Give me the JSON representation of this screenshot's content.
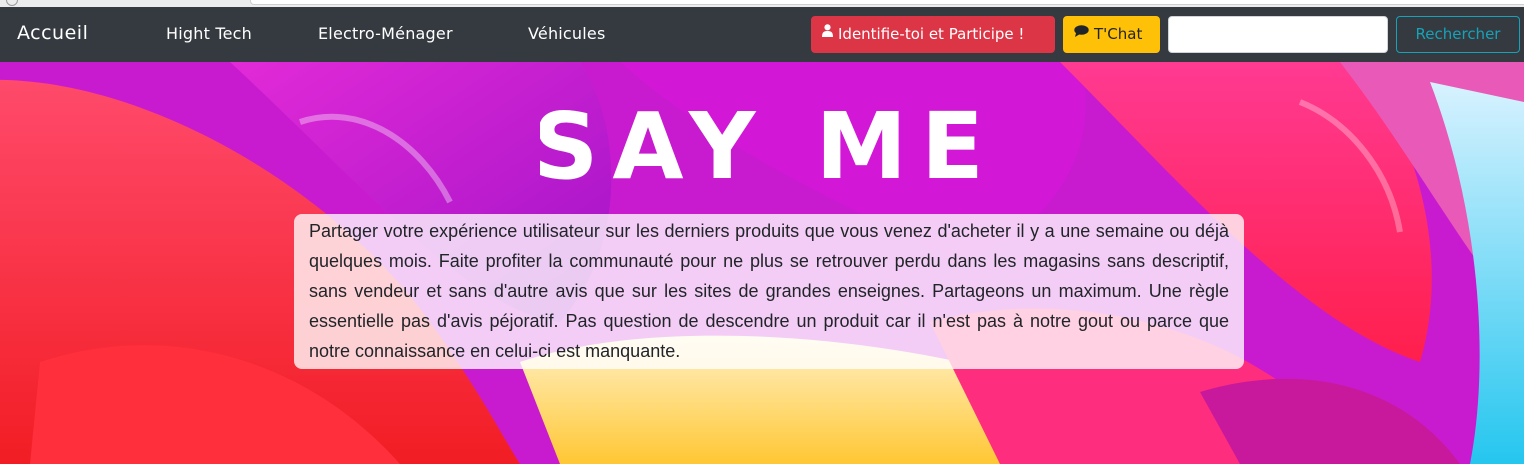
{
  "navbar": {
    "brand": "Accueil",
    "links": [
      {
        "label": "Hight Tech"
      },
      {
        "label": "Electro-Ménager"
      },
      {
        "label": "Véhicules"
      }
    ],
    "login_button": {
      "label": "Identifie-toi et Participe !",
      "icon": "user-icon"
    },
    "chat_button": {
      "label": "T'Chat",
      "icon": "comment-icon"
    },
    "search": {
      "value": "",
      "placeholder": ""
    },
    "search_button": {
      "label": "Rechercher"
    }
  },
  "hero": {
    "logo_text": "SAY ME",
    "description": "Partager votre expérience utilisateur sur les derniers produits que vous venez d'acheter il y a une semaine ou déjà quelques mois. Faite profiter la communauté pour ne plus se retrouver perdu dans les magasins sans descriptif, sans vendeur et sans d'autre avis que sur les sites de grandes enseignes. Partageons un maximum. Une règle essentielle pas d'avis péjoratif. Pas question de descendre un produit car il n'est pas à notre gout ou parce que notre connaissance en celui-ci est manquante."
  },
  "colors": {
    "navbar_bg": "#343a40",
    "danger": "#dc3545",
    "warning": "#ffc107",
    "info": "#17a2b8"
  }
}
